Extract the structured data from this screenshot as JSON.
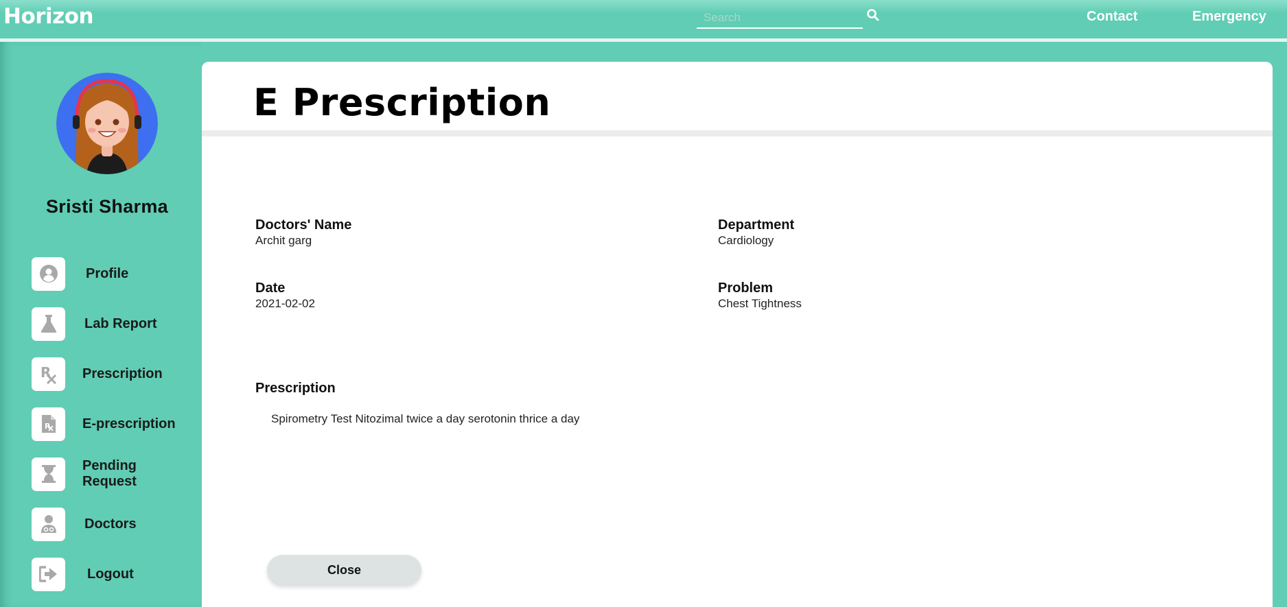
{
  "header": {
    "logo": "Horizon",
    "search": {
      "placeholder": "Search",
      "value": ""
    },
    "nav": {
      "contact": "Contact",
      "emergency": "Emergency"
    }
  },
  "sidebar": {
    "user_name": "Sristi Sharma",
    "items": [
      {
        "label": "Profile",
        "icon": "user-circle-icon"
      },
      {
        "label": "Lab Report",
        "icon": "flask-icon"
      },
      {
        "label": "Prescription",
        "icon": "rx-icon"
      },
      {
        "label": "E-prescription",
        "icon": "rx-file-icon"
      },
      {
        "label": "Pending Request",
        "icon": "hourglass-icon"
      },
      {
        "label": "Doctors",
        "icon": "doctor-icon"
      },
      {
        "label": "Logout",
        "icon": "logout-icon"
      }
    ]
  },
  "main": {
    "title": "E Prescription",
    "fields": {
      "doctor_label": "Doctors' Name",
      "doctor_value": "Archit garg",
      "department_label": "Department",
      "department_value": "Cardiology",
      "date_label": "Date",
      "date_value": "2021-02-02",
      "problem_label": "Problem",
      "problem_value": "Chest Tightness"
    },
    "prescription_label": "Prescription",
    "prescription_text": "Spirometry Test Nitozimal twice a day serotonin thrice a day",
    "close_label": "Close"
  },
  "colors": {
    "teal": "#60cdb4",
    "avatar_bg": "#3d6ff0",
    "icon_gray": "#a9a9a9"
  }
}
